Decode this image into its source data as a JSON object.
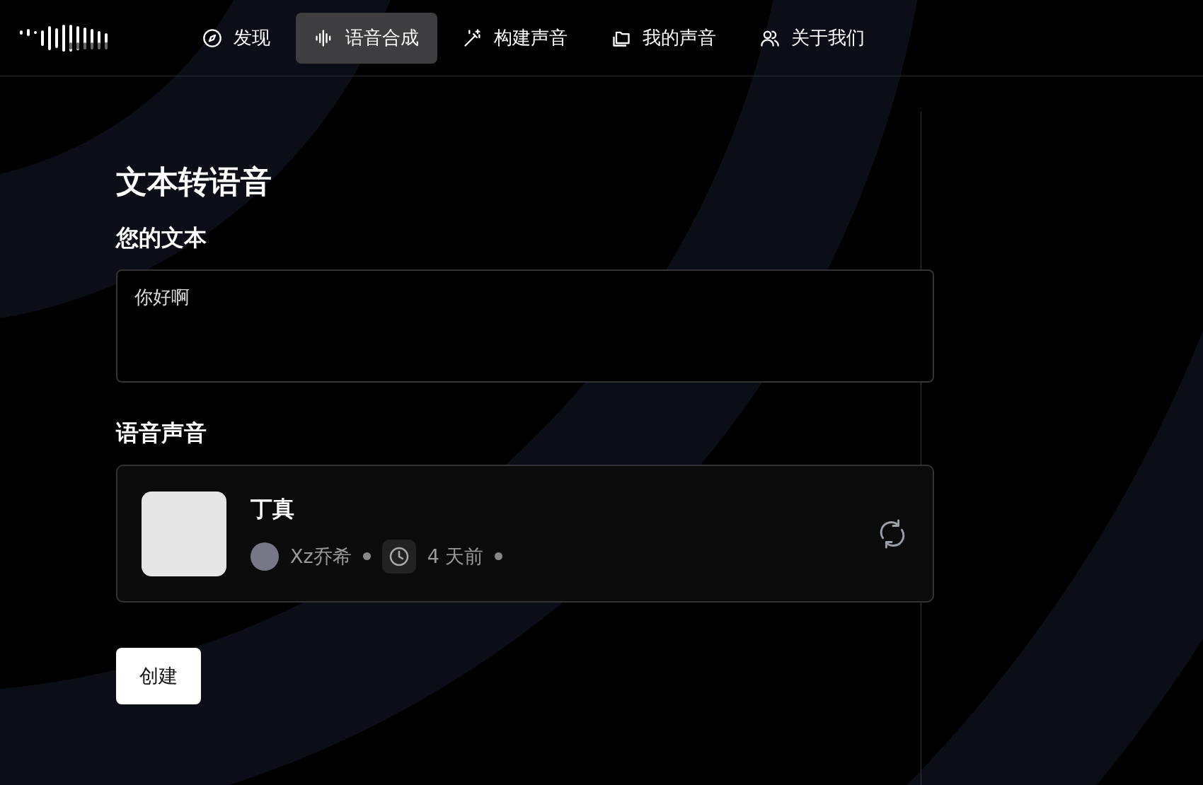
{
  "nav": {
    "items": [
      {
        "label": "发现",
        "selected": false
      },
      {
        "label": "语音合成",
        "selected": true
      },
      {
        "label": "构建声音",
        "selected": false
      },
      {
        "label": "我的声音",
        "selected": false
      },
      {
        "label": "关于我们",
        "selected": false
      }
    ]
  },
  "main": {
    "title": "文本转语音",
    "text_label": "您的文本",
    "text_value": "你好啊",
    "voice_label": "语音声音",
    "voice": {
      "name": "丁真",
      "author": "Xz乔希",
      "time": "4 天前"
    },
    "create_button": "创建"
  }
}
